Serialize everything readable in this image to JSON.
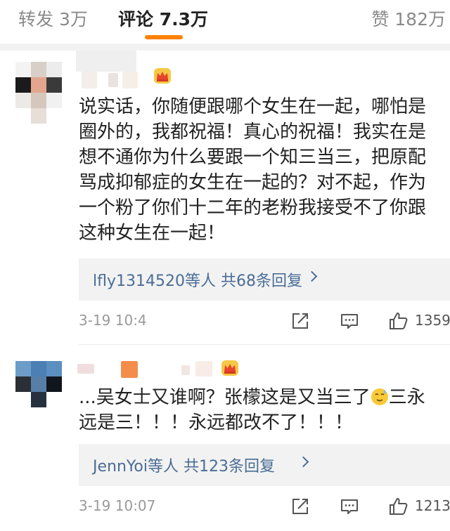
{
  "tabs": {
    "repost": "转发 3万",
    "comments": "评论 7.3万",
    "likes": "赞 182万"
  },
  "comments": [
    {
      "lines": [
        "说实话，你随便跟哪个女生在一起，哪怕是",
        "圈外的，我都祝福！真心的祝福！我实在是",
        "想不通你为什么要跟一个知三当三，把原配",
        "骂成抑郁症的女生在一起的？对不起，作为",
        "一个粉了你们十二年的老粉我接受不了你跟",
        "这种女生在一起！"
      ],
      "replies": "lfly1314520等人  共68条回复",
      "time": "3-19 10:4",
      "likes": "1359"
    },
    {
      "line1_before": "...吴女士又谁啊？张檬这是又当三了",
      "line1_after": "三永",
      "line2": "远是三！！！永远都改不了！！！",
      "replies": "JennYoi等人  共123条回复",
      "time": "3-19 10:07",
      "likes": "1213"
    }
  ],
  "colors": {
    "accent": "#ff8200",
    "link": "#4a6d96",
    "muted": "#9a9a9a",
    "panel": "#f2f2f2"
  },
  "icons": [
    "crown-badge-icon",
    "share-icon",
    "comment-icon",
    "thumbs-up-icon",
    "chevron-right-icon",
    "sweat-emoji-icon"
  ]
}
